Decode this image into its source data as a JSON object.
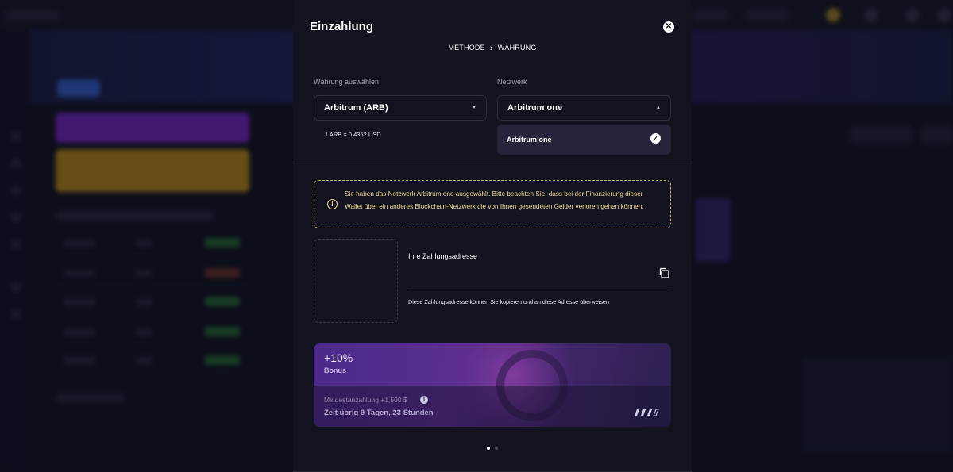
{
  "modal": {
    "title": "Einzahlung",
    "close_icon": "close-icon",
    "breadcrumb": {
      "step1": "METHODE",
      "separator": "›",
      "step2": "WÄHRUNG"
    }
  },
  "currency": {
    "label": "Währung auswählen",
    "selected": "Arbitrum (ARB)",
    "rate": "1 ARB = 0.4352 USD"
  },
  "network": {
    "label": "Netzwerk",
    "selected": "Arbitrum one",
    "options": [
      {
        "label": "Arbitrum one",
        "checked": true
      }
    ]
  },
  "warning": {
    "text": "Sie haben das Netzwerk Arbitrum one ausgewählt. Bitte beachten Sie, dass bei der Finanzierung dieser Wallet über ein anderes Blockchain-Netzwerk die von Ihnen gesendeten Gelder verloren gehen können."
  },
  "address": {
    "label": "Ihre Zahlungsadresse",
    "value": "",
    "hint": "Diese Zahlungsadresse können Sie kopieren und an diese Adresse überweisen"
  },
  "bonus": {
    "percent": "+10%",
    "label": "Bonus",
    "min_deposit": "Mindestanzahlung +1,500 $",
    "time_left": "Zeit übrig 9 Tagen, 23 Stunden"
  },
  "pager": {
    "pages": 2,
    "active": 0
  },
  "colors": {
    "modal_bg": "#13131f",
    "warning_border": "#c9b56a",
    "warning_text": "#f3dd94",
    "bonus_purple": "#4a2a8a"
  }
}
